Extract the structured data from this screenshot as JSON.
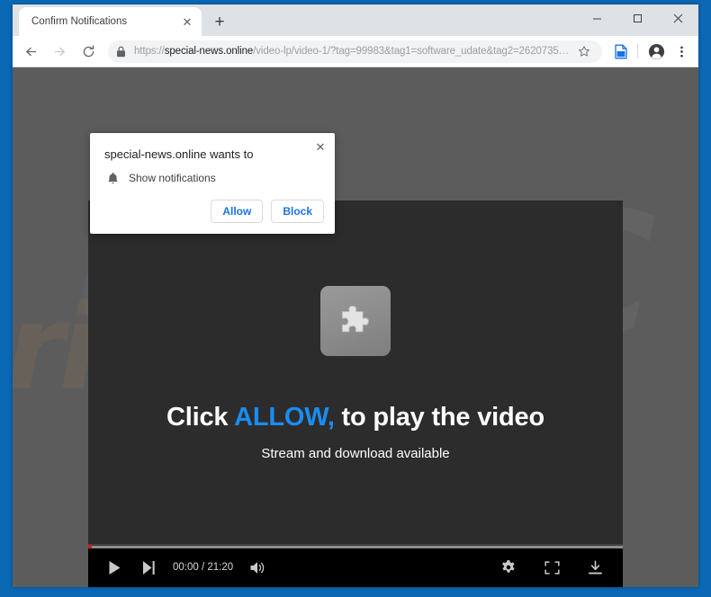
{
  "window": {
    "minimize_label": "Minimize",
    "maximize_label": "Maximize",
    "close_label": "Close"
  },
  "tabs": {
    "active_title": "Confirm Notifications",
    "close_glyph": "✕",
    "new_tab_glyph": "+"
  },
  "toolbar": {
    "back_label": "Back",
    "forward_label": "Forward",
    "reload_label": "Reload",
    "url_scheme": "https://",
    "url_host": "special-news.online",
    "url_path": "/video-lp/video-1/?tag=99983&tag1=software_udate&tag2=2620735…",
    "url_full": "https://special-news.online/video-lp/video-1/?tag=99983&tag1=software_udate&tag2=2620735…",
    "bookmark_label": "Bookmark this page",
    "reading_list_label": "Reading list",
    "profile_label": "Profile",
    "menu_label": "Customize and control Google Chrome"
  },
  "permission_bubble": {
    "title": "special-news.online wants to",
    "option_label": "Show notifications",
    "option_icon": "bell-icon",
    "allow_label": "Allow",
    "block_label": "Block",
    "close_glyph": "✕"
  },
  "video": {
    "plugin_icon": "puzzle-piece-icon",
    "headline_prefix": "Click ",
    "headline_highlight": "ALLOW,",
    "headline_suffix": " to play the video",
    "subline": "Stream and download available",
    "time_display": "00:00 / 21:20",
    "current_time": "00:00",
    "duration": "21:20",
    "progress_percent": 0,
    "play_label": "Play",
    "next_label": "Next",
    "volume_label": "Mute",
    "settings_label": "Settings",
    "fullscreen_label": "Full screen",
    "download_label": "Download"
  },
  "page_background": {
    "watermark_text": "risk.com",
    "logo_text": "EVIC"
  },
  "colors": {
    "desktop_blue": "#0a68b5",
    "chrome_chrome": "#dee1e6",
    "page_gray": "#5c5c5c",
    "video_dark": "#2c2c2c",
    "controls_black": "#000000",
    "allow_blue": "#1a8cf2",
    "link_blue": "#1a73e8",
    "progress_red": "#cc1f2d"
  }
}
